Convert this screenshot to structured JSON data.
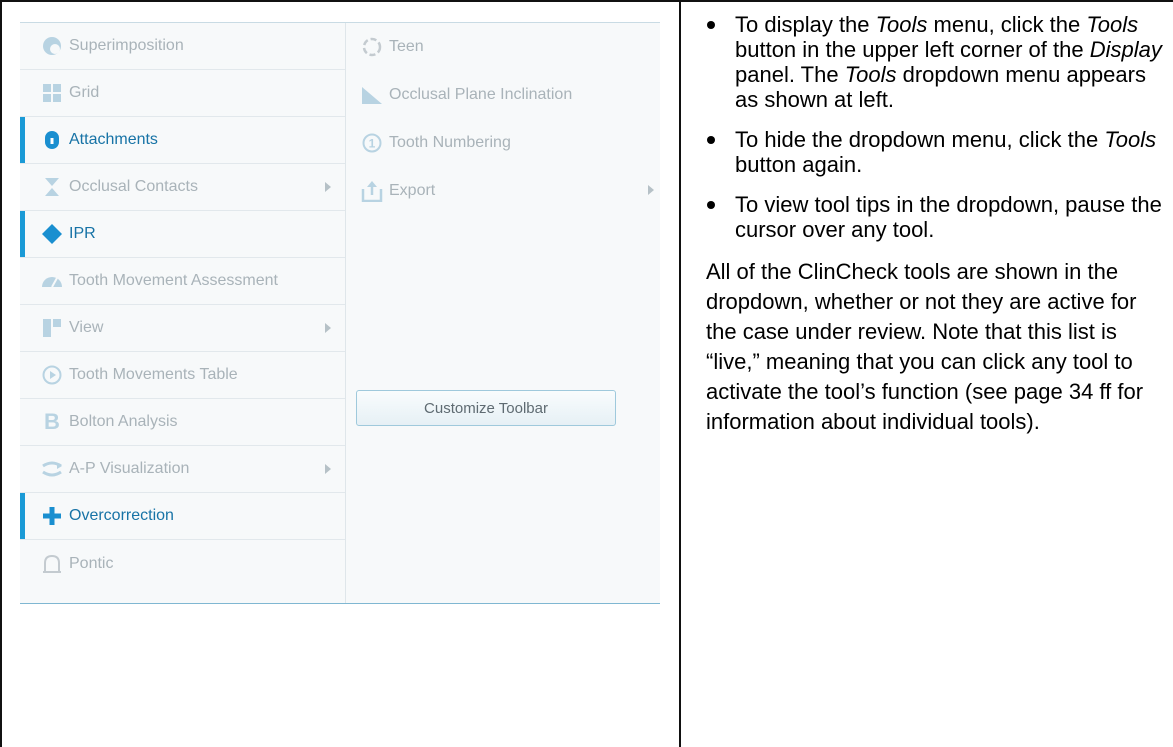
{
  "menu": {
    "left_items": [
      {
        "label": "Superimposition",
        "icon": "superimposition-icon",
        "active": false,
        "submenu": false
      },
      {
        "label": "Grid",
        "icon": "grid-icon",
        "active": false,
        "submenu": false
      },
      {
        "label": "Attachments",
        "icon": "attachment-icon",
        "active": true,
        "submenu": false
      },
      {
        "label": "Occlusal Contacts",
        "icon": "occlusal-contacts-icon",
        "active": false,
        "submenu": true
      },
      {
        "label": "IPR",
        "icon": "diamond-icon",
        "active": true,
        "submenu": false
      },
      {
        "label": "Tooth Movement Assessment",
        "icon": "gauge-icon",
        "active": false,
        "submenu": false
      },
      {
        "label": "View",
        "icon": "view-icon",
        "active": false,
        "submenu": true
      },
      {
        "label": "Tooth Movements Table",
        "icon": "play-circle-icon",
        "active": false,
        "submenu": false
      },
      {
        "label": "Bolton Analysis",
        "icon": "bolton-b-icon",
        "active": false,
        "submenu": false
      },
      {
        "label": "A-P Visualization",
        "icon": "ap-visualization-icon",
        "active": false,
        "submenu": true
      },
      {
        "label": "Overcorrection",
        "icon": "plus-icon",
        "active": true,
        "submenu": false
      },
      {
        "label": "Pontic",
        "icon": "pontic-icon",
        "active": false,
        "submenu": false
      }
    ],
    "right_items": [
      {
        "label": "Teen",
        "icon": "teen-icon",
        "active": false,
        "submenu": false
      },
      {
        "label": "Occlusal Plane Inclination",
        "icon": "inclination-icon",
        "active": false,
        "submenu": false
      },
      {
        "label": "Tooth Numbering",
        "icon": "numbering-icon",
        "active": false,
        "submenu": false
      },
      {
        "label": "Export",
        "icon": "export-icon",
        "active": false,
        "submenu": true
      }
    ],
    "customize_button": "Customize Toolbar",
    "colors": {
      "active_text": "#1773a6",
      "active_bar": "#1a9ad6",
      "icon_active": "#1a8fd0",
      "icon_inactive": "#b8d3e2",
      "text_inactive": "#a9b3b9"
    }
  },
  "instructions": {
    "b1_a": "To display the ",
    "b1_b": "Tools",
    "b1_c": " menu, click the ",
    "b1_d": "Tools",
    "b1_e": " button in the upper left corner of the ",
    "b1_f": "Display",
    "b1_g": " panel. The ",
    "b1_h": "Tools",
    "b1_i": " dropdown menu appears as shown at left.",
    "b2_a": "To hide the dropdown menu, click the ",
    "b2_b": "Tools",
    "b2_c": " button again.",
    "b3": "To view tool tips in the dropdown, pause the cursor over any tool.",
    "paragraph": "All of the ClinCheck tools are shown in the dropdown, whether or not they are active for the case under review. Note that this list is “live,” meaning that you can click any tool to activate the tool’s function (see page 34 ff for information about individual tools)."
  }
}
